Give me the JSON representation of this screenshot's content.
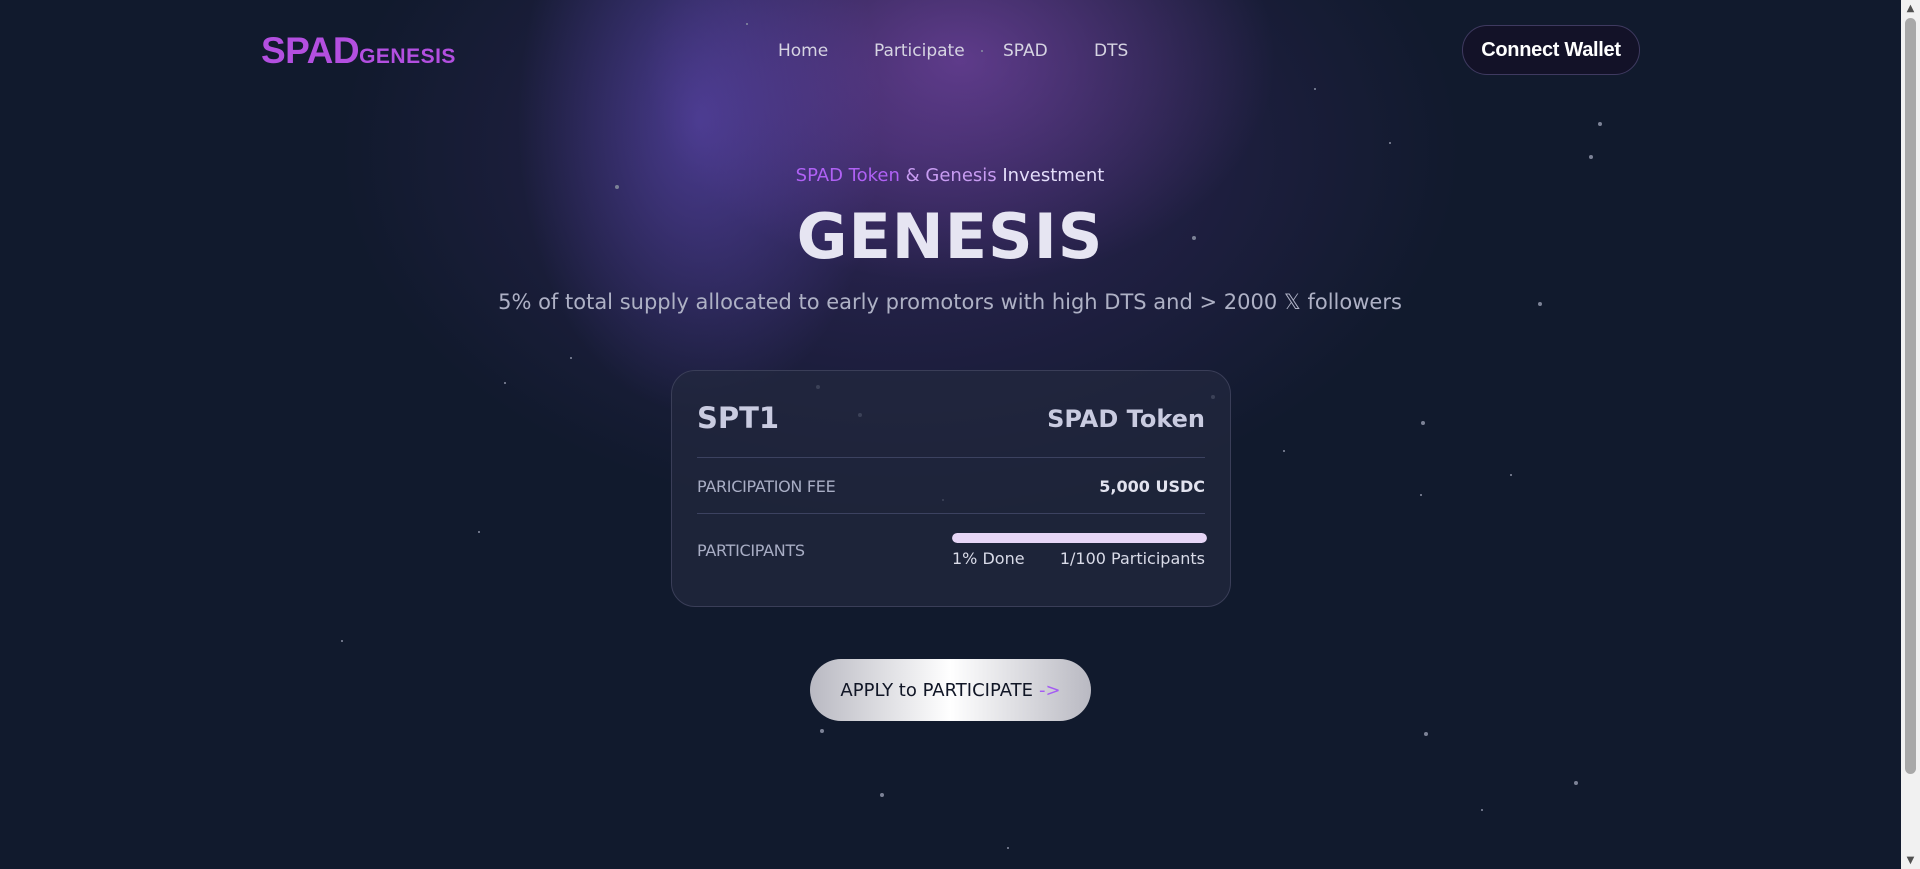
{
  "header": {
    "logo_main": "SPAD",
    "logo_sub": "GENESIS",
    "nav": [
      "Home",
      "Participate",
      "SPAD",
      "DTS"
    ],
    "connect_wallet": "Connect Wallet"
  },
  "hero": {
    "kicker_part1": "SPAD Token",
    "kicker_part2": " & Genesis",
    "kicker_part3": " Investment",
    "title": "GENESIS",
    "subtitle": "5% of total supply allocated to early promotors with high DTS and > 2000 𝕏 followers"
  },
  "card": {
    "name": "SPT1",
    "token": "SPAD Token",
    "fee_label": "PARICIPATION FEE",
    "fee_value": "5,000 USDC",
    "participants_label": "PARTICIPANTS",
    "progress_percent": 1,
    "progress_text": "1% Done",
    "participants_text": "1/100 Participants"
  },
  "cta": {
    "label": "APPLY to PARTICIPATE",
    "arrow": "->"
  },
  "colors": {
    "background": "#111a2d",
    "accent_purple": "#b34fe0",
    "progress_fill": "#e6d6f6"
  }
}
